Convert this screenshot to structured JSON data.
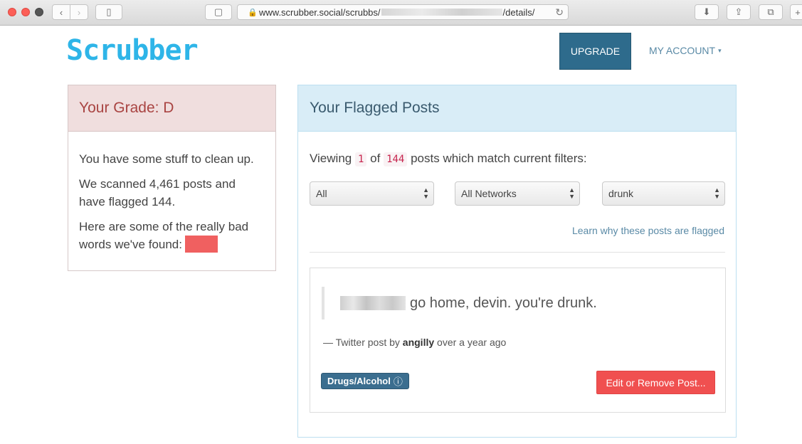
{
  "browser": {
    "url_prefix": "www.scrubber.social/scrubbs/",
    "url_suffix": "/details/",
    "icons": {
      "back": "‹",
      "forward": "›",
      "sidebar": "▯",
      "reader": "▢",
      "lock": "🔒",
      "reload": "↻",
      "download": "⬇",
      "share": "⇪",
      "tabs": "⧉",
      "new_tab": "+"
    }
  },
  "header": {
    "logo": "Scrubber",
    "upgrade_label": "UPGRADE",
    "account_label": "MY ACCOUNT",
    "account_caret": "▾"
  },
  "grade": {
    "title": "Your Grade: D",
    "line1": "You have some stuff to clean up.",
    "line2": "We scanned 4,461 posts and have flagged 144.",
    "line3": "Here are some of the really bad words we've found:"
  },
  "flagged": {
    "title": "Your Flagged Posts",
    "viewing_prefix": "Viewing",
    "viewing_current": "1",
    "viewing_of": "of",
    "viewing_total": "144",
    "viewing_suffix": "posts which match current filters:",
    "filters": [
      "All",
      "All Networks",
      "drunk"
    ],
    "learn_link": "Learn why these posts are flagged",
    "post": {
      "text": "go home, devin. you're drunk.",
      "attribution_prefix": "— Twitter post by",
      "author": "angilly",
      "attribution_suffix": "over a year ago",
      "tag": "Drugs/Alcohol",
      "tag_info_icon": "ⓘ",
      "edit_label": "Edit or Remove Post..."
    }
  },
  "colors": {
    "brand": "#2eb5e8",
    "upgrade": "#2e6b8c",
    "grade_text": "#a94442",
    "danger": "#f05050",
    "tag": "#3b6e8f"
  }
}
